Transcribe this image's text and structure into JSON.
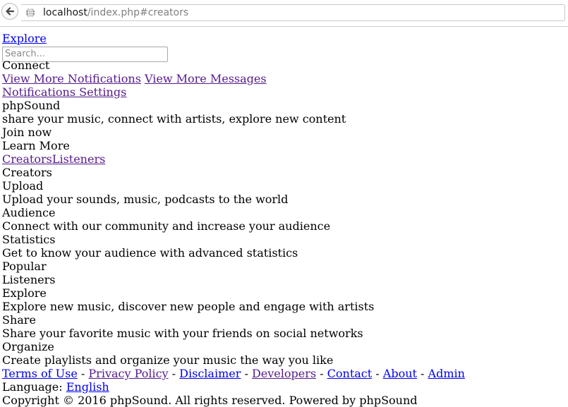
{
  "browser": {
    "url_host": "localhost",
    "url_path": "/index.php#creators"
  },
  "header": {
    "explore_link": "Explore",
    "search_placeholder": "Search...",
    "connect": "Connect",
    "view_more_notifications": "View More Notifications",
    "view_more_messages": "View More Messages",
    "notifications_settings": "Notifications Settings"
  },
  "hero": {
    "brand": "phpSound",
    "tagline": "share your music, connect with artists, explore new content",
    "join_now": "Join now",
    "learn_more": "Learn More"
  },
  "tabs": {
    "creators": "Creators",
    "listeners": "Listeners"
  },
  "creators": {
    "title": "Creators",
    "features": [
      {
        "title": "Upload",
        "desc": "Upload your sounds, music, podcasts to the world"
      },
      {
        "title": "Audience",
        "desc": "Connect with our community and increase your audience"
      },
      {
        "title": "Statistics",
        "desc": "Get to know your audience with advanced statistics"
      }
    ],
    "popular": "Popular"
  },
  "listeners": {
    "title": "Listeners",
    "features": [
      {
        "title": "Explore",
        "desc": "Explore new music, discover new people and engage with artists"
      },
      {
        "title": "Share",
        "desc": "Share your favorite music with your friends on social networks"
      },
      {
        "title": "Organize",
        "desc": "Create playlists and organize your music the way you like"
      }
    ]
  },
  "footer": {
    "links": [
      "Terms of Use",
      "Privacy Policy",
      "Disclaimer",
      "Developers",
      "Contact",
      "About",
      "Admin"
    ],
    "separator": " - ",
    "language_label": "Language: ",
    "language_value": "English",
    "copyright": "Copyright © 2016 phpSound. All rights reserved. Powered by phpSound"
  }
}
